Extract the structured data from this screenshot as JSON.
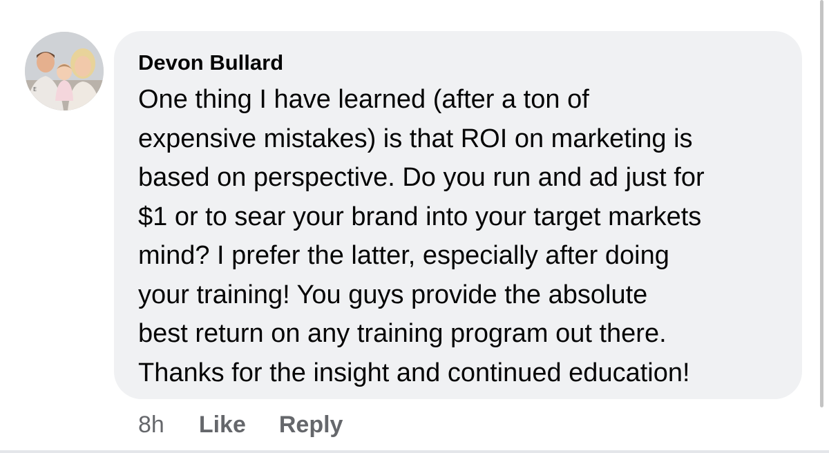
{
  "comment": {
    "author": "Devon Bullard",
    "body_lines": [
      "One thing I have learned (after a ton of",
      "expensive mistakes) is that ROI on marketing is",
      "based on perspective. Do you run and ad just for",
      "$1 or to sear your brand into your target markets",
      "mind? I prefer the latter, especially after doing",
      "your training! You guys provide the absolute",
      "best return on any training program out there.",
      "Thanks for the insight and continued education!"
    ],
    "timestamp": "8h",
    "like_label": "Like",
    "reply_label": "Reply"
  },
  "colors": {
    "bubble_background": "#f0f1f3",
    "text": "#050505",
    "secondary_text": "#65676b"
  }
}
